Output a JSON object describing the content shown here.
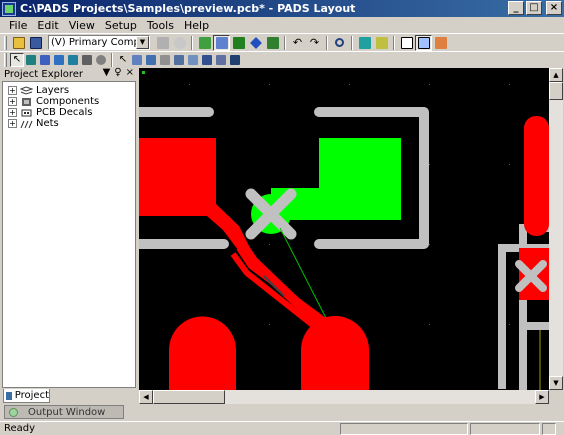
{
  "window": {
    "title": "C:\\PADS Projects\\Samples\\preview.pcb* - PADS Layout",
    "buttons": [
      "_",
      "□",
      "×"
    ]
  },
  "menu": [
    "File",
    "Edit",
    "View",
    "Setup",
    "Tools",
    "Help"
  ],
  "toolbar": {
    "layer_combo_value": "(V) Primary Componen",
    "icons": [
      "open-icon",
      "save-icon",
      "layer-dropdown",
      "copy-icon",
      "redraw-icon",
      "design-icon",
      "grid-icon",
      "board-icon",
      "route-icon",
      "component-icon",
      "undo-icon",
      "redo-icon",
      "zoom-icon",
      "display-icon",
      "brush-icon",
      "select-icon",
      "window-icon",
      "pattern-icon"
    ]
  },
  "toolbar2": {
    "icons": [
      "select-arrow-icon",
      "route-icon",
      "align-icon",
      "move-icon",
      "rotate-icon",
      "pad-icon",
      "via-icon",
      "arrow-icon",
      "move-vertical-icon",
      "move-horizontal-icon",
      "dim-icon",
      "space-icon",
      "flip-icon",
      "distribute-icon",
      "sort-icon",
      "layer-icon"
    ]
  },
  "project_explorer": {
    "title": "Project Explorer",
    "header_buttons": [
      "▼",
      "♀",
      "×"
    ],
    "items": [
      {
        "label": "Layers",
        "icon": "layers-icon"
      },
      {
        "label": "Components",
        "icon": "components-icon"
      },
      {
        "label": "PCB Decals",
        "icon": "pcb-decals-icon"
      },
      {
        "label": "Nets",
        "icon": "nets-icon"
      }
    ],
    "tab": "Project"
  },
  "output_window": {
    "label": "Output Window"
  },
  "status": {
    "text": "Ready"
  },
  "colors": {
    "pad_red": "#ff0000",
    "pad_green": "#00ff00",
    "silk_gray": "#c0c0c0",
    "canvas": "#000000",
    "ratsnest": "#00c000"
  }
}
